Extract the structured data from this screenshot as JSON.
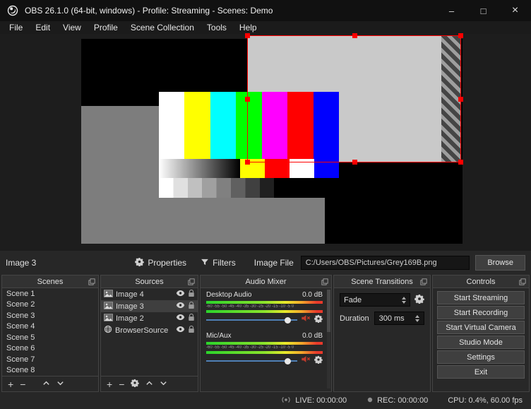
{
  "window": {
    "title": "OBS 26.1.0 (64-bit, windows) - Profile: Streaming - Scenes: Demo",
    "min_glyph": "–",
    "max_glyph": "□",
    "close_glyph": "×"
  },
  "menu": {
    "items": [
      "File",
      "Edit",
      "View",
      "Profile",
      "Scene Collection",
      "Tools",
      "Help"
    ]
  },
  "source_toolbar": {
    "source_name": "Image 3",
    "properties_label": "Properties",
    "filters_label": "Filters",
    "image_file_label": "Image File",
    "image_file_value": "C:/Users/OBS/Pictures/Grey169B.png",
    "browse_label": "Browse"
  },
  "scenes": {
    "title": "Scenes",
    "items": [
      "Scene 1",
      "Scene 2",
      "Scene 3",
      "Scene 4",
      "Scene 5",
      "Scene 6",
      "Scene 7",
      "Scene 8"
    ]
  },
  "sources": {
    "title": "Sources",
    "selected_source": "Image 3",
    "items": [
      {
        "name": "Image 4",
        "icon": "image"
      },
      {
        "name": "Image 3",
        "icon": "image"
      },
      {
        "name": "Image 2",
        "icon": "image"
      },
      {
        "name": "BrowserSource",
        "icon": "globe"
      }
    ]
  },
  "audio_mixer": {
    "title": "Audio Mixer",
    "scale_text": "-60 -55 -50 -45 -40 -35 -30 -25 -20 -15 -10 -5 0",
    "channels": [
      {
        "name": "Desktop Audio",
        "level": "0.0 dB",
        "muted": true
      },
      {
        "name": "Mic/Aux",
        "level": "0.0 dB",
        "muted": true
      }
    ]
  },
  "transitions": {
    "title": "Scene Transitions",
    "transition_value": "Fade",
    "duration_label": "Duration",
    "duration_value": "300 ms"
  },
  "controls_panel": {
    "title": "Controls",
    "buttons": [
      "Start Streaming",
      "Start Recording",
      "Start Virtual Camera",
      "Studio Mode",
      "Settings",
      "Exit"
    ]
  },
  "status_bar": {
    "live": "LIVE: 00:00:00",
    "rec": "REC: 00:00:00",
    "cpu": "CPU: 0.4%, 60.00 fps"
  },
  "colors": {
    "selection_red": "#ff0000",
    "mute_red": "#c0392b",
    "slider_blue": "#4f7fb5",
    "meter_green": "#2bd42b",
    "meter_yellow": "#e9e92b",
    "meter_red": "#e8392b"
  }
}
